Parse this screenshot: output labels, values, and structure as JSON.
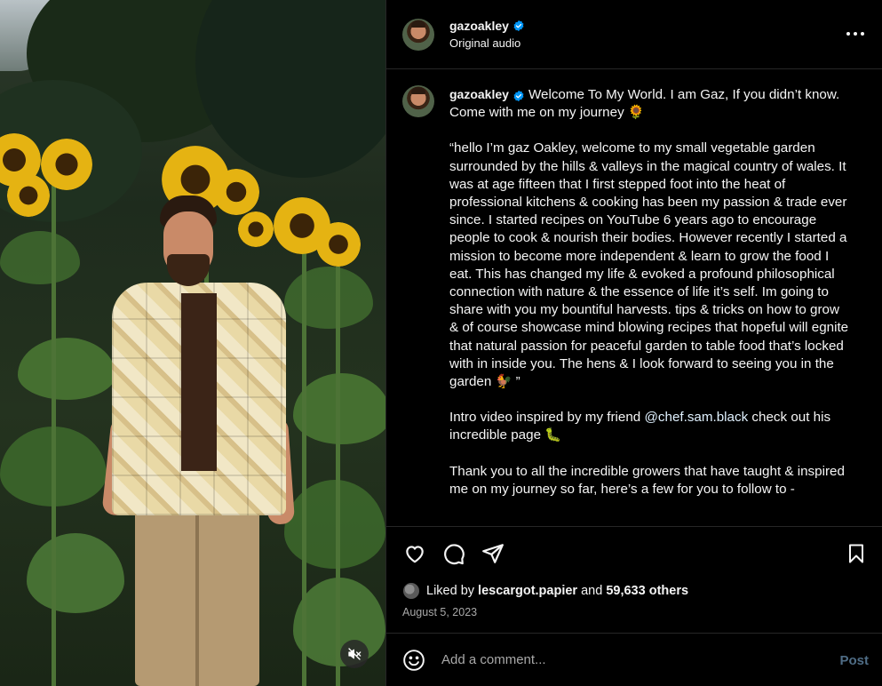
{
  "post": {
    "username": "gazoakley",
    "audio_label": "Original audio"
  },
  "caption": {
    "username": "gazoakley",
    "text_1": "Welcome To My World. I am Gaz, If you didn’t know. Come with me on my journey 🌻",
    "text_2": "“hello I’m gaz Oakley, welcome to my small vegetable garden surrounded by the hills & valleys in the magical country of wales. It was at age fifteen that I first stepped foot into the heat of professional kitchens & cooking has been my passion & trade ever since. I started recipes on YouTube 6 years ago to encourage people to cook & nourish their bodies. However recently I started a mission to become more independent & learn to grow the food I eat. This has changed my life & evoked a profound philosophical connection with nature & the essence of life it’s self. Im going to share with you my bountiful harvests. tips & tricks on how to grow & of course showcase mind blowing recipes that hopeful will egnite that natural passion for peaceful garden to table food that’s locked with in inside you. The hens & I look forward to seeing you in the garden 🐓 ”",
    "text_3_before": "Intro video inspired by my friend ",
    "text_3_mention": "@chef.sam.black",
    "text_3_after": " check out his incredible page 🐛",
    "text_4": "Thank you to all the incredible growers that have taught & inspired me on my journey so far, here’s a few for you to follow to -"
  },
  "likes": {
    "prefix": "Liked by",
    "user": "lescargot.papier",
    "middle": "and",
    "count": "59,633 others"
  },
  "date": "August 5, 2023",
  "comment": {
    "placeholder": "Add a comment...",
    "post_label": "Post"
  },
  "colors": {
    "background": "#000000",
    "text": "#f5f5f5",
    "muted": "#a8a8a8",
    "verified": "#0095f6",
    "post_disabled": "#4f6d86"
  },
  "icons": [
    "verified-badge-icon",
    "more-options-icon",
    "heart-icon",
    "comment-icon",
    "share-icon",
    "bookmark-icon",
    "emoji-icon",
    "mute-icon"
  ]
}
